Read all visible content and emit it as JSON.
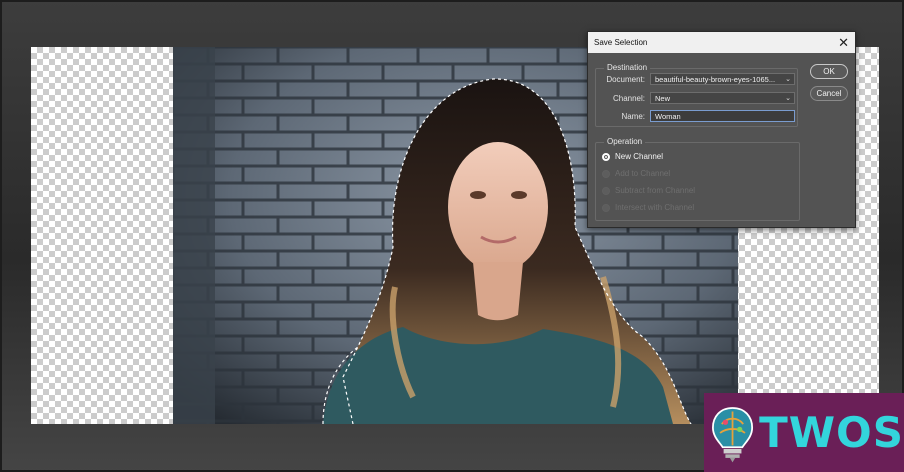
{
  "dialog": {
    "title": "Save Selection",
    "close_icon": "close-icon",
    "destination": {
      "legend": "Destination",
      "document_label": "Document:",
      "document_value": "beautiful-beauty-brown-eyes-1065...",
      "channel_label": "Channel:",
      "channel_value": "New",
      "name_label": "Name:",
      "name_value": "Woman"
    },
    "operation": {
      "legend": "Operation",
      "options": [
        {
          "label": "New Channel",
          "selected": true,
          "enabled": true
        },
        {
          "label": "Add to Channel",
          "selected": false,
          "enabled": false
        },
        {
          "label": "Subtract from Channel",
          "selected": false,
          "enabled": false
        },
        {
          "label": "Intersect with Channel",
          "selected": false,
          "enabled": false
        }
      ]
    },
    "ok_label": "OK",
    "cancel_label": "Cancel"
  },
  "watermark": {
    "text": "TWOS",
    "icon": "lightbulb-brain-icon",
    "brand_color": "#6a1f57",
    "accent_color": "#33d5dc"
  },
  "colors": {
    "dialog_bg": "#535353",
    "titlebar_bg": "#f0f0f0",
    "workspace_bg": "#2e2e2e"
  }
}
